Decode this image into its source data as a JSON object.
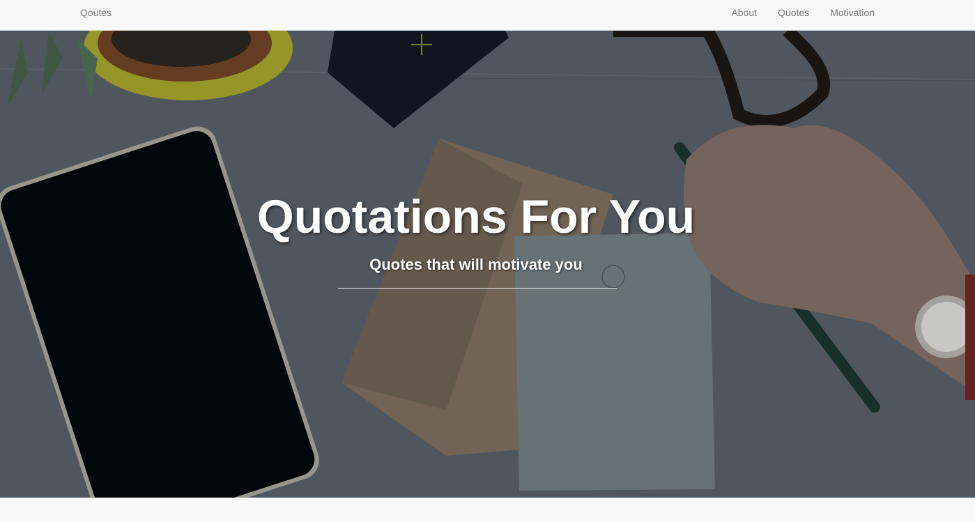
{
  "navbar": {
    "brand": "Qoutes",
    "links": [
      {
        "label": "About"
      },
      {
        "label": "Quotes"
      },
      {
        "label": "Motivation"
      }
    ]
  },
  "hero": {
    "title": "Quotations For You",
    "subtitle": "Quotes that will motivate you"
  },
  "colors": {
    "navbar_bg": "#f8f8f8",
    "nav_text": "#777777",
    "hero_text": "#ffffff"
  }
}
